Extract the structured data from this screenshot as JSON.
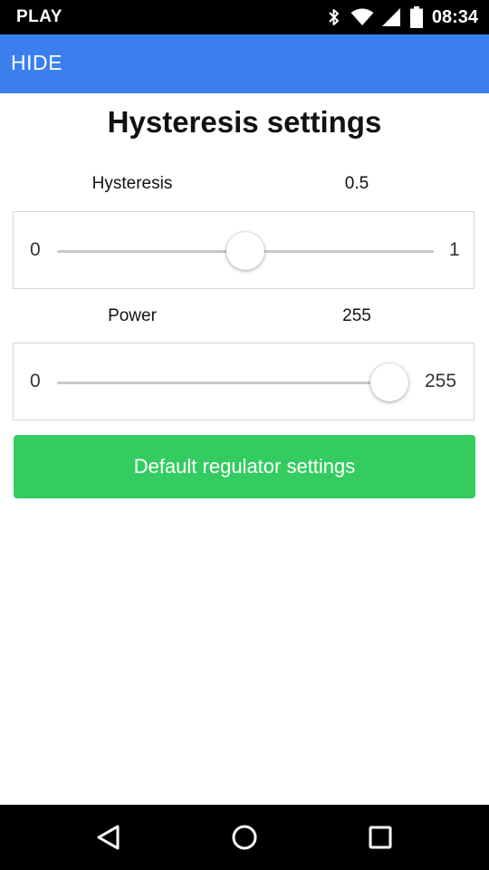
{
  "status_bar": {
    "carrier": "PLAY",
    "time": "08:34",
    "icons": [
      "bluetooth-icon",
      "wifi-icon",
      "cell-signal-icon",
      "battery-icon"
    ]
  },
  "app_bar": {
    "hide_label": "HIDE",
    "color": "#3b7fef"
  },
  "main": {
    "title": "Hysteresis settings",
    "hysteresis": {
      "label": "Hysteresis",
      "value": "0.5",
      "min": "0",
      "max": "1",
      "level": 0.5
    },
    "power": {
      "label": "Power",
      "value": "255",
      "min": "0",
      "max": "255",
      "level": 1.0
    },
    "default_button_label": "Default regulator settings",
    "button_color": "#34cc60"
  },
  "nav_bar": {
    "icons": [
      "back-icon",
      "home-icon",
      "recents-icon"
    ]
  }
}
